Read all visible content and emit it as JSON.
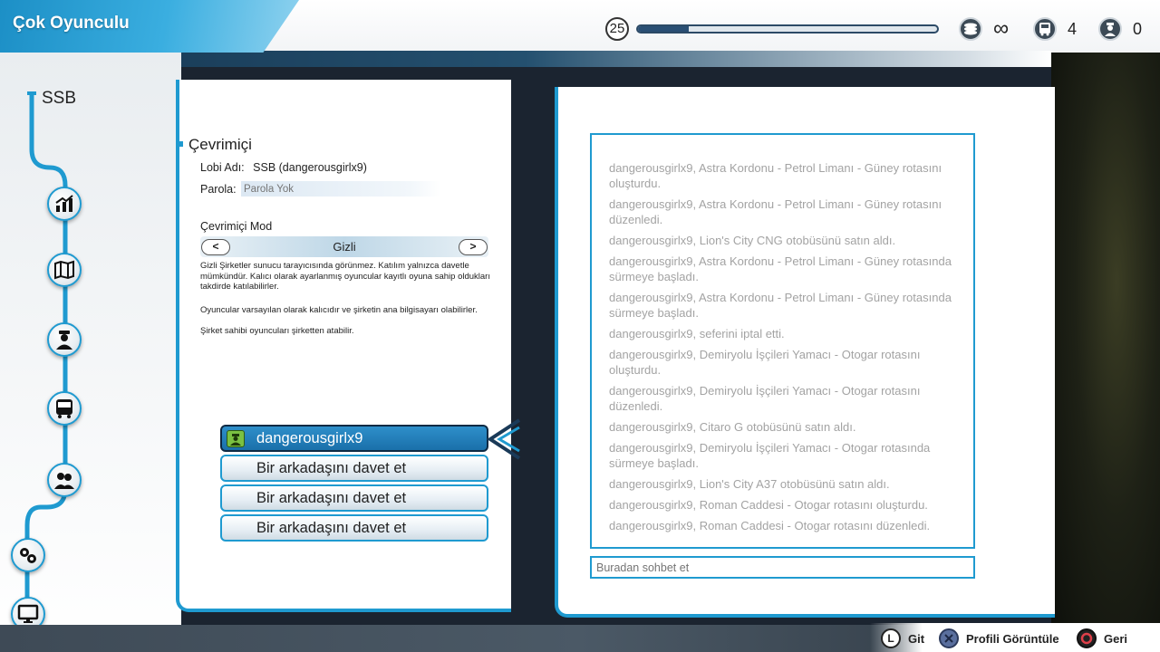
{
  "header": {
    "title": "Çok Oyunculu",
    "level": "25",
    "xp_progress": 0.17,
    "money": "∞",
    "buses": "4",
    "drivers": "0"
  },
  "sidebar": {
    "company": "SSB",
    "items": [
      {
        "name": "statistics",
        "icon": "chart-icon"
      },
      {
        "name": "map",
        "icon": "map-icon"
      },
      {
        "name": "drivers",
        "icon": "driver-icon"
      },
      {
        "name": "buses",
        "icon": "bus-icon"
      },
      {
        "name": "players",
        "icon": "players-icon"
      },
      {
        "name": "settings",
        "icon": "gears-icon"
      },
      {
        "name": "computer",
        "icon": "monitor-icon"
      }
    ]
  },
  "online": {
    "title": "Çevrimiçi",
    "lobby_label": "Lobi Adı:",
    "lobby_value": "SSB (dangerousgirlx9)",
    "password_label": "Parola:",
    "password_placeholder": "Parola Yok",
    "mode_label": "Çevrimiçi Mod",
    "mode_prev": "<",
    "mode_next": ">",
    "mode_value": "Gizli",
    "mode_desc_1": "Gizli Şirketler sunucu tarayıcısında görünmez. Katılım yalnızca davetle mümkündür. Kalıcı olarak ayarlanmış oyuncular kayıtlı oyuna sahip oldukları takdirde katılabilirler.",
    "mode_desc_2": "Oyuncular varsayılan olarak kalıcıdır ve şirketin ana bilgisayarı olabilirler.",
    "mode_desc_3": "Şirket sahibi oyuncuları şirketten atabilir."
  },
  "players": [
    {
      "label": "dangerousgirlx9",
      "active": true
    },
    {
      "label": "Bir arkadaşını davet et",
      "active": false
    },
    {
      "label": "Bir arkadaşını davet et",
      "active": false
    },
    {
      "label": "Bir arkadaşını davet et",
      "active": false
    }
  ],
  "chat": {
    "messages": [
      "dangerousgirlx9, Astra Kordonu - Petrol Limanı - Güney rotasını oluşturdu.",
      "dangerousgirlx9, Astra Kordonu - Petrol Limanı - Güney rotasını düzenledi.",
      "dangerousgirlx9, Lion's City CNG otobüsünü satın aldı.",
      "dangerousgirlx9, Astra Kordonu - Petrol Limanı - Güney rotasında sürmeye başladı.",
      "dangerousgirlx9, Astra Kordonu - Petrol Limanı - Güney rotasında sürmeye başladı.",
      "dangerousgirlx9, seferini iptal etti.",
      "dangerousgirlx9, Demiryolu İşçileri Yamacı - Otogar rotasını oluşturdu.",
      "dangerousgirlx9, Demiryolu İşçileri Yamacı - Otogar rotasını düzenledi.",
      "dangerousgirlx9, Citaro G otobüsünü satın aldı.",
      "dangerousgirlx9, Demiryolu İşçileri Yamacı - Otogar rotasında sürmeye başladı.",
      "dangerousgirlx9, Lion's City A37 otobüsünü satın aldı.",
      "dangerousgirlx9, Roman Caddesi - Otogar rotasını oluşturdu.",
      "dangerousgirlx9, Roman Caddesi - Otogar rotasını düzenledi."
    ],
    "input_placeholder": "Buradan sohbet et"
  },
  "hints": {
    "go_key": "L",
    "go_label": "Git",
    "profile_label": "Profili Görüntüle",
    "back_label": "Geri"
  },
  "colors": {
    "accent": "#1f9ad0",
    "active_slot": "#1a70aa"
  }
}
